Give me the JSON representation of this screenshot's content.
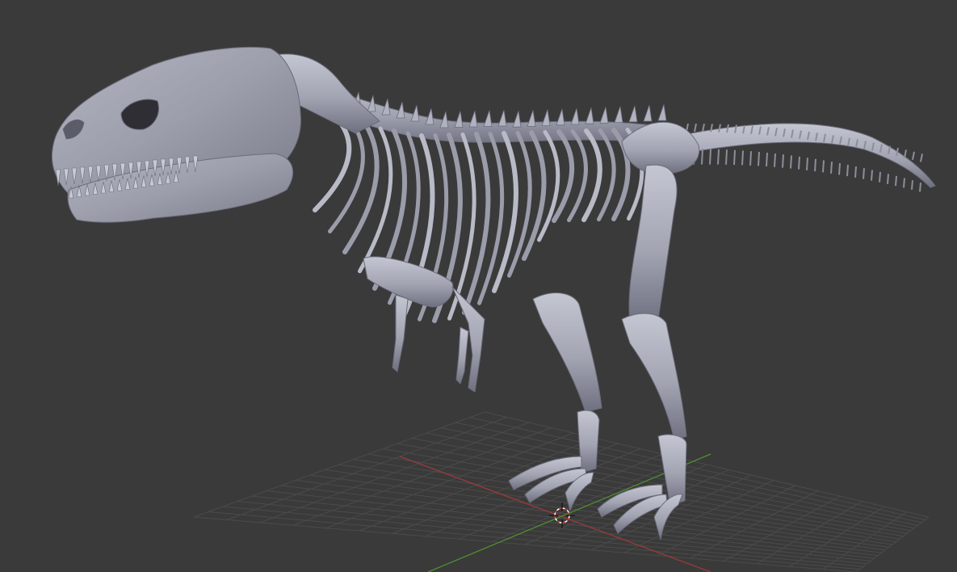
{
  "viewport": {
    "background_color": "#3a3a3a",
    "grid_color": "#4b4b4b",
    "x_axis_color": "#9a3a3a",
    "y_axis_color": "#4f8f2f",
    "model_color": "#a2a4b2"
  },
  "scene": {
    "model": "trex-skeleton-mesh",
    "cursor_icon": "3d-cursor-icon"
  }
}
